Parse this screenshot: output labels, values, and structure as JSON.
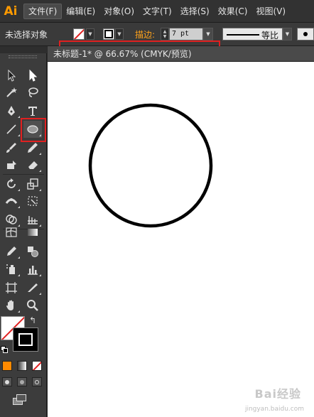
{
  "app": {
    "logo": "Ai"
  },
  "menu": {
    "items": [
      {
        "label": "文件(F)",
        "active": true
      },
      {
        "label": "编辑(E)"
      },
      {
        "label": "对象(O)"
      },
      {
        "label": "文字(T)"
      },
      {
        "label": "选择(S)"
      },
      {
        "label": "效果(C)"
      },
      {
        "label": "视图(V)"
      }
    ]
  },
  "control_bar": {
    "selection_status": "未选择对象",
    "fill": {
      "icon": "none-swatch",
      "color": "#ffffff"
    },
    "stroke": {
      "icon": "stroke-swatch",
      "color": "#000000"
    },
    "stroke_label": "描边:",
    "stroke_weight": "7 pt",
    "profile_label": "等比",
    "highlight_color": "#e02020"
  },
  "document": {
    "tab_title": "未标题-1* @ 66.67% (CMYK/预览)"
  },
  "canvas": {
    "shape": "ellipse",
    "stroke_color": "#000000",
    "fill": "none"
  },
  "watermark": {
    "text": "Bai经验",
    "subtext": "jingyan.baidu.com"
  },
  "tools": {
    "selected": "ellipse-tool",
    "fill_stroke": {
      "fill": "none",
      "stroke": "#000000"
    },
    "color_modes": [
      "#ff8a00",
      "gradient",
      "none"
    ]
  }
}
